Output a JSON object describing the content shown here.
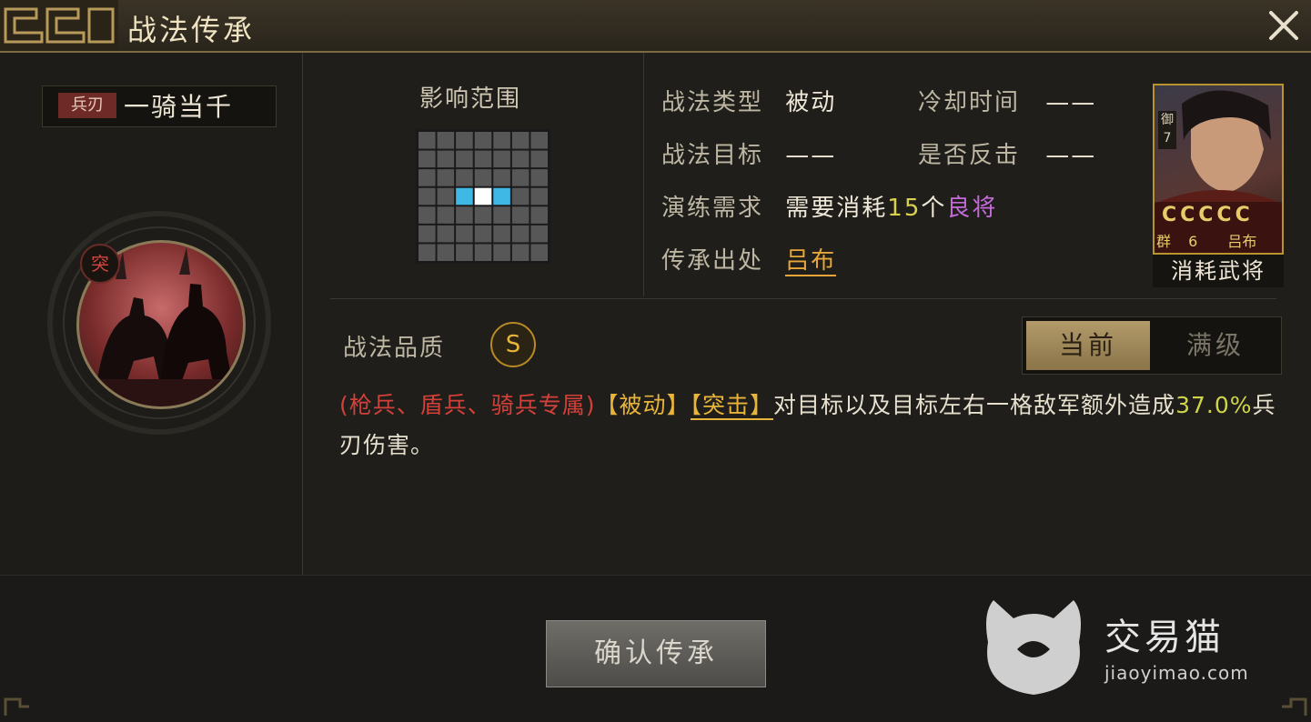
{
  "window": {
    "title": "战法传承",
    "close_icon": "close-icon"
  },
  "left": {
    "weapon_tag": "兵刃",
    "skill_name": "一骑当千",
    "type_badge": "突"
  },
  "range": {
    "label": "影响范围",
    "grid_size": 7,
    "highlighted_cells": [
      {
        "row": 3,
        "col": 2,
        "kind": "target"
      },
      {
        "row": 3,
        "col": 3,
        "kind": "center"
      },
      {
        "row": 3,
        "col": 4,
        "kind": "target"
      }
    ],
    "colors": {
      "cell": "#575757",
      "target": "#3fb8e6",
      "center": "#ffffff"
    }
  },
  "attributes": {
    "type_label": "战法类型",
    "type_value": "被动",
    "cooldown_label": "冷却时间",
    "cooldown_value": "——",
    "target_label": "战法目标",
    "target_value": "——",
    "counter_label": "是否反击",
    "counter_value": "——",
    "drill_label": "演练需求",
    "drill_pre": "需要消耗",
    "drill_count": "15",
    "drill_unit": "个",
    "drill_item": "良将",
    "origin_label": "传承出处",
    "origin_value": "吕布"
  },
  "general": {
    "troop": "御",
    "troop_level": "7",
    "stars": "CCCCC",
    "faction": "群",
    "cost": "6",
    "name": "吕布",
    "caption": "消耗武将"
  },
  "quality": {
    "label": "战法品质",
    "grade": "S"
  },
  "tabs": {
    "current": "当前",
    "max": "满级",
    "active": "current"
  },
  "description": {
    "p1": "(枪兵、盾兵、骑兵专属)",
    "p2": "【被动】",
    "p3": "【突击】",
    "p4": "对目标以及目标左右一格敌军额外造成",
    "p5": "37.0%",
    "p6": "兵刃伤害。"
  },
  "footer": {
    "confirm": "确认传承"
  },
  "watermark": {
    "name": "交易猫",
    "url": "jiaoyimao.com"
  },
  "colors": {
    "accent_gold": "#e8b43a",
    "accent_red": "#d3403a",
    "accent_purple": "#c26bd9",
    "cell_blue": "#3fb8e6"
  }
}
